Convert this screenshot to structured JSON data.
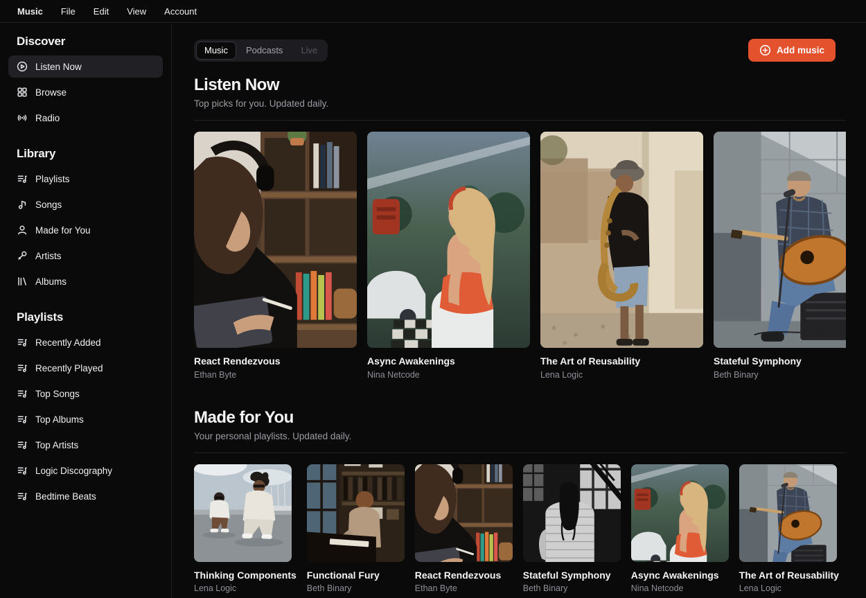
{
  "menubar": {
    "items": [
      {
        "label": "Music",
        "bold": true
      },
      {
        "label": "File",
        "bold": false
      },
      {
        "label": "Edit",
        "bold": false
      },
      {
        "label": "View",
        "bold": false
      },
      {
        "label": "Account",
        "bold": false
      }
    ]
  },
  "sidebar": {
    "sections": [
      {
        "title": "Discover",
        "items": [
          {
            "label": "Listen Now",
            "icon": "play-circle-icon",
            "active": true
          },
          {
            "label": "Browse",
            "icon": "grid-icon",
            "active": false
          },
          {
            "label": "Radio",
            "icon": "radio-icon",
            "active": false
          }
        ]
      },
      {
        "title": "Library",
        "items": [
          {
            "label": "Playlists",
            "icon": "list-music-icon",
            "active": false
          },
          {
            "label": "Songs",
            "icon": "music-note-icon",
            "active": false
          },
          {
            "label": "Made for You",
            "icon": "user-icon",
            "active": false
          },
          {
            "label": "Artists",
            "icon": "mic-icon",
            "active": false
          },
          {
            "label": "Albums",
            "icon": "library-icon",
            "active": false
          }
        ]
      },
      {
        "title": "Playlists",
        "items": [
          {
            "label": "Recently Added",
            "icon": "list-music-icon",
            "active": false
          },
          {
            "label": "Recently Played",
            "icon": "list-music-icon",
            "active": false
          },
          {
            "label": "Top Songs",
            "icon": "list-music-icon",
            "active": false
          },
          {
            "label": "Top Albums",
            "icon": "list-music-icon",
            "active": false
          },
          {
            "label": "Top Artists",
            "icon": "list-music-icon",
            "active": false
          },
          {
            "label": "Logic Discography",
            "icon": "list-music-icon",
            "active": false
          },
          {
            "label": "Bedtime Beats",
            "icon": "list-music-icon",
            "active": false
          }
        ]
      }
    ]
  },
  "main": {
    "tabs": [
      {
        "label": "Music",
        "active": true,
        "disabled": false
      },
      {
        "label": "Podcasts",
        "active": false,
        "disabled": false
      },
      {
        "label": "Live",
        "active": false,
        "disabled": true
      }
    ],
    "add_music": {
      "label": "Add music",
      "icon": "circle-plus-icon"
    },
    "listen_now": {
      "title": "Listen Now",
      "subtitle": "Top picks for you. Updated daily.",
      "albums": [
        {
          "title": "React Rendezvous",
          "artist": "Ethan Byte",
          "art": "reading-woman-headphones"
        },
        {
          "title": "Async Awakenings",
          "artist": "Nina Netcode",
          "art": "blonde-woman-window"
        },
        {
          "title": "The Art of Reusability",
          "artist": "Lena Logic",
          "art": "saxophone-street"
        },
        {
          "title": "Stateful Symphony",
          "artist": "Beth Binary",
          "art": "street-guitarist"
        }
      ]
    },
    "made_for_you": {
      "title": "Made for You",
      "subtitle": "Your personal playlists. Updated daily.",
      "albums": [
        {
          "title": "Thinking Components",
          "artist": "Lena Logic",
          "art": "harbor-duo"
        },
        {
          "title": "Functional Fury",
          "artist": "Beth Binary",
          "art": "piano-room"
        },
        {
          "title": "React Rendezvous",
          "artist": "Ethan Byte",
          "art": "reading-woman-headphones"
        },
        {
          "title": "Stateful Symphony",
          "artist": "Beth Binary",
          "art": "wicker-chair-bw"
        },
        {
          "title": "Async Awakenings",
          "artist": "Nina Netcode",
          "art": "blonde-woman-window"
        },
        {
          "title": "The Art of Reusability",
          "artist": "Lena Logic",
          "art": "street-guitarist"
        }
      ]
    }
  },
  "colors": {
    "background": "#0a0a0b",
    "accent": "#e3512d",
    "active_item": "#212125",
    "muted_text": "#9b9ba3"
  }
}
